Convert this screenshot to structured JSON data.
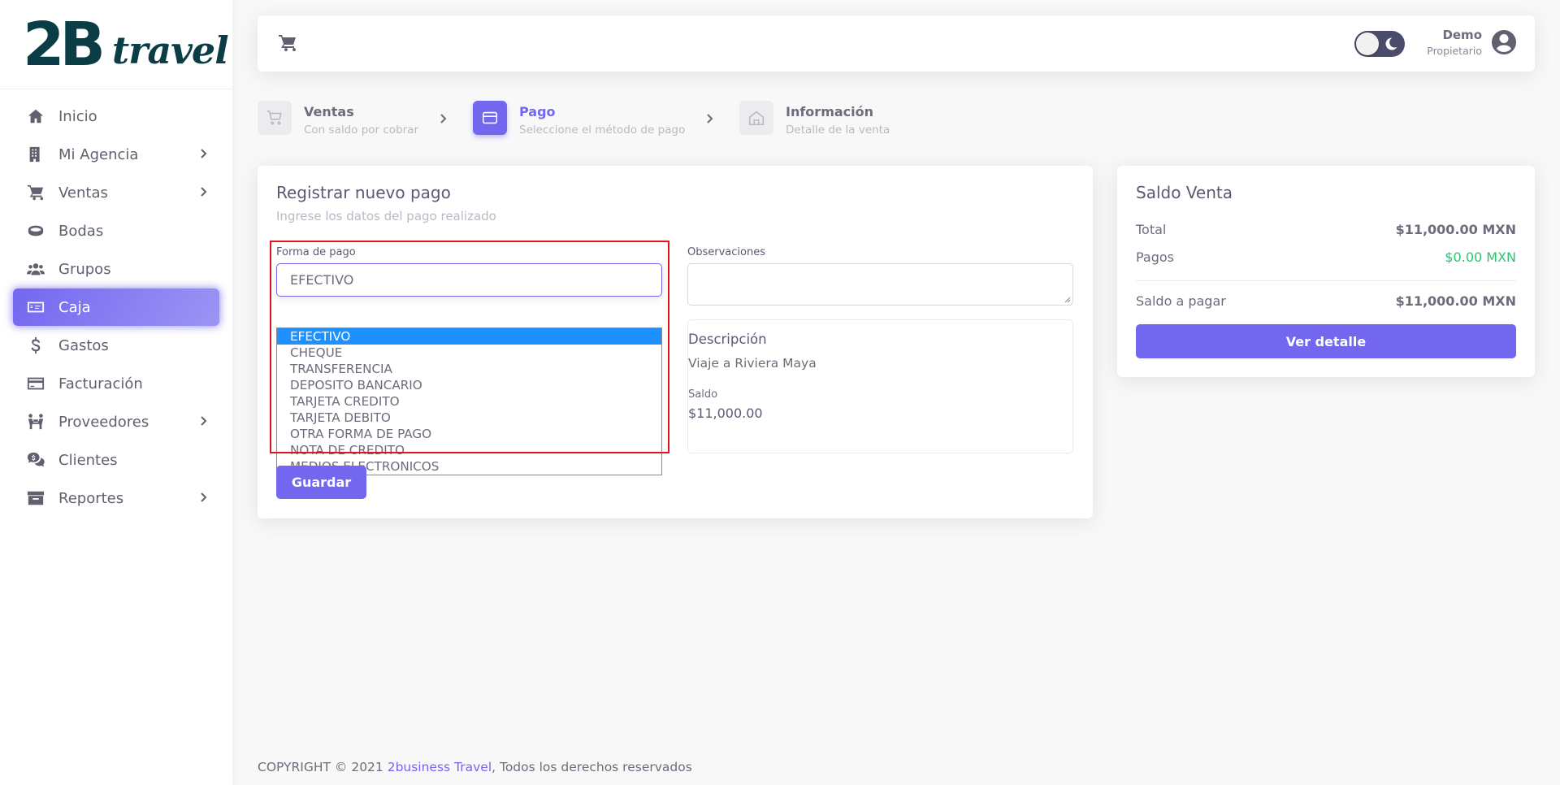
{
  "brand": {
    "logo_main": "2B",
    "logo_script": "travel"
  },
  "sidebar": {
    "items": [
      {
        "label": "Inicio",
        "icon": "home-icon",
        "has_submenu": false,
        "active": false
      },
      {
        "label": "Mi Agencia",
        "icon": "building-icon",
        "has_submenu": true,
        "active": false
      },
      {
        "label": "Ventas",
        "icon": "cart-icon",
        "has_submenu": true,
        "active": false
      },
      {
        "label": "Bodas",
        "icon": "ring-icon",
        "has_submenu": false,
        "active": false
      },
      {
        "label": "Grupos",
        "icon": "users-icon",
        "has_submenu": false,
        "active": false
      },
      {
        "label": "Caja",
        "icon": "money-icon",
        "has_submenu": false,
        "active": true
      },
      {
        "label": "Gastos",
        "icon": "dollar-icon",
        "has_submenu": false,
        "active": false
      },
      {
        "label": "Facturación",
        "icon": "credit-card-icon",
        "has_submenu": false,
        "active": false
      },
      {
        "label": "Proveedores",
        "icon": "people-carry-icon",
        "has_submenu": true,
        "active": false
      },
      {
        "label": "Clientes",
        "icon": "comments-dollar-icon",
        "has_submenu": false,
        "active": false
      },
      {
        "label": "Reportes",
        "icon": "archive-icon",
        "has_submenu": true,
        "active": false
      }
    ]
  },
  "navbar": {
    "user_name": "Demo",
    "user_role": "Propietario",
    "theme_toggle": "dark-mode-toggle"
  },
  "stepper": {
    "steps": [
      {
        "title": "Ventas",
        "subtitle": "Con saldo por cobrar",
        "icon": "cart-outline-icon",
        "active": false
      },
      {
        "title": "Pago",
        "subtitle": "Seleccione el método de pago",
        "icon": "credit-card-outline-icon",
        "active": true
      },
      {
        "title": "Información",
        "subtitle": "Detalle de la venta",
        "icon": "home-outline-icon",
        "active": false
      }
    ]
  },
  "payment_form": {
    "title": "Registrar nuevo pago",
    "subtitle": "Ingrese los datos del pago realizado",
    "method_label": "Forma de pago",
    "method_value": "EFECTIVO",
    "method_options": [
      "EFECTIVO",
      "CHEQUE",
      "TRANSFERENCIA",
      "DEPOSITO BANCARIO",
      "TARJETA CREDITO",
      "TARJETA DEBITO",
      "OTRA FORMA DE PAGO",
      "NOTA DE CREDITO",
      "MEDIOS ELECTRONICOS"
    ],
    "notes_label": "Observaciones",
    "notes_value": "",
    "description_title": "Descripción",
    "description_value": "Viaje a Riviera Maya",
    "balance_label": "Saldo",
    "balance_value": "$11,000.00",
    "save_label": "Guardar"
  },
  "summary": {
    "title": "Saldo Venta",
    "total_label": "Total",
    "total_value": "$11,000.00 MXN",
    "payments_label": "Pagos",
    "payments_value": "$0.00 MXN",
    "due_label": "Saldo a pagar",
    "due_value": "$11,000.00 MXN",
    "detail_button": "Ver detalle"
  },
  "footer": {
    "prefix": "COPYRIGHT © 2021 ",
    "link": "2business Travel",
    "suffix": ", Todos los derechos reservados"
  },
  "colors": {
    "primary": "#7367f0",
    "success": "#28c76f",
    "highlight": "#1e90ff",
    "frame": "#e0141f"
  }
}
